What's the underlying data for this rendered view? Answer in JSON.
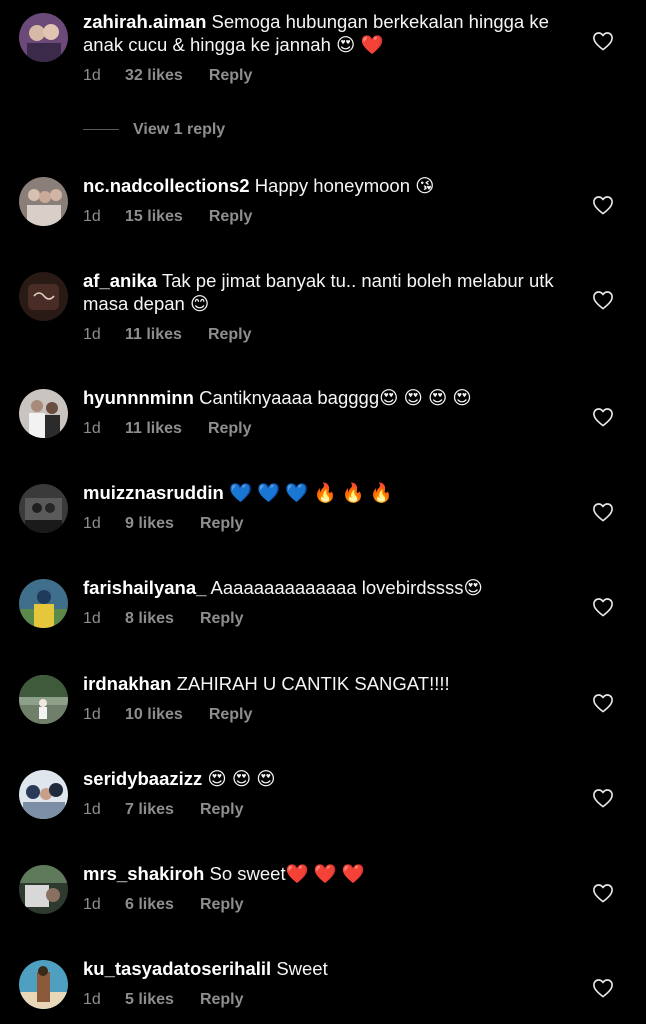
{
  "comments": [
    {
      "username": "zahirah.aiman",
      "text": "Semoga hubungan berkekalan hingga ke anak cucu & hingga ke jannah 😍 ❤️",
      "age": "1d",
      "likes": "32 likes",
      "reply": "Reply",
      "avatar_color": "#6b4a7a"
    },
    {
      "username": "nc.nadcollections2",
      "text": "Happy honeymoon 😘",
      "age": "1d",
      "likes": "15 likes",
      "reply": "Reply",
      "avatar_color": "#8a7f78"
    },
    {
      "username": "af_anika",
      "text": "Tak pe jimat banyak tu.. nanti boleh melabur utk masa depan 😊",
      "age": "1d",
      "likes": "11 likes",
      "reply": "Reply",
      "avatar_color": "#4a2c26"
    },
    {
      "username": "hyunnnminn",
      "text": "Cantiknyaaaa bagggg😍 😍 😍 😍",
      "age": "1d",
      "likes": "11 likes",
      "reply": "Reply",
      "avatar_color": "#c9c4bf"
    },
    {
      "username": "muizznasruddin",
      "text": "💙 💙 💙 🔥 🔥 🔥",
      "age": "1d",
      "likes": "9 likes",
      "reply": "Reply",
      "avatar_color": "#3a3a3a"
    },
    {
      "username": "farishailyana_",
      "text": "Aaaaaaaaaaaaaa lovebirdssss😍",
      "age": "1d",
      "likes": "8 likes",
      "reply": "Reply",
      "avatar_color": "#3f6f8a"
    },
    {
      "username": "irdnakhan",
      "text": "ZAHIRAH U CANTIK SANGAT!!!!",
      "age": "1d",
      "likes": "10 likes",
      "reply": "Reply",
      "avatar_color": "#5b6b55"
    },
    {
      "username": "seridybaazizz",
      "text": "😍 😍 😍",
      "age": "1d",
      "likes": "7 likes",
      "reply": "Reply",
      "avatar_color": "#7d8fa6"
    },
    {
      "username": "mrs_shakiroh",
      "text": "So sweet❤️ ❤️ ❤️",
      "age": "1d",
      "likes": "6 likes",
      "reply": "Reply",
      "avatar_color": "#5f6a5a"
    },
    {
      "username": "ku_tasyadatoserihalil",
      "text": "Sweet",
      "age": "1d",
      "likes": "5 likes",
      "reply": "Reply",
      "avatar_color": "#4f9fc0"
    }
  ],
  "view_replies": {
    "label": "View 1 reply"
  },
  "icons": {
    "like": "heart-outline-icon"
  },
  "colors": {
    "background": "#000000",
    "text": "#ffffff",
    "secondary": "#8e8e8e"
  }
}
